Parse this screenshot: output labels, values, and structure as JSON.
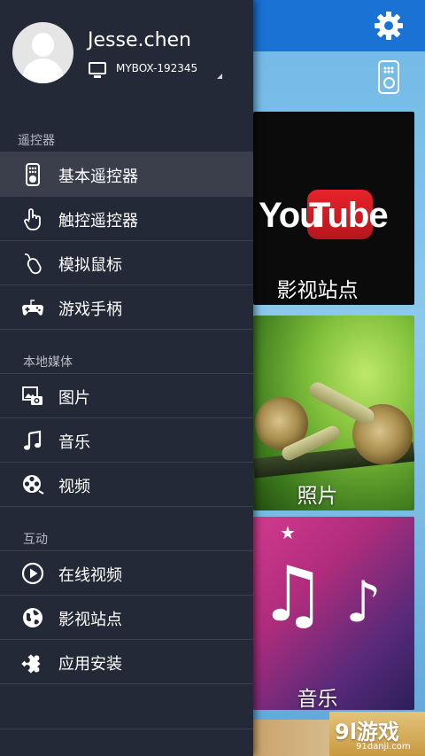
{
  "profile": {
    "user_name": "Jesse.chen",
    "device_name": "MYBOX-192345"
  },
  "drawer": {
    "sections": [
      {
        "header": "遥控器",
        "items": [
          {
            "label": "基本遥控器",
            "icon": "remote-icon",
            "selected": true
          },
          {
            "label": "触控遥控器",
            "icon": "touch-hand-icon"
          },
          {
            "label": "模拟鼠标",
            "icon": "mouse-icon"
          },
          {
            "label": "游戏手柄",
            "icon": "gamepad-icon"
          }
        ]
      },
      {
        "header": "本地媒体",
        "items": [
          {
            "label": "图片",
            "icon": "pictures-icon"
          },
          {
            "label": "音乐",
            "icon": "music-note-icon"
          },
          {
            "label": "视频",
            "icon": "film-reel-icon"
          }
        ]
      },
      {
        "header": "互动",
        "items": [
          {
            "label": "在线视频",
            "icon": "play-circle-icon"
          },
          {
            "label": "影视站点",
            "icon": "globe-icon"
          },
          {
            "label": "应用安装",
            "icon": "puzzle-icon"
          }
        ]
      }
    ]
  },
  "background": {
    "tiles": [
      {
        "caption": "影视站点",
        "logo_left": "You",
        "logo_right": "Tube"
      },
      {
        "caption": "照片"
      },
      {
        "caption": "音乐"
      }
    ],
    "watermark": {
      "logo": "9l游戏",
      "url": "91danji.com"
    }
  },
  "colors": {
    "drawer_bg": "#232936",
    "selected_bg": "#3a3f4b",
    "topbar_blue": "#1a72d4",
    "youtube_red": "#e8232b"
  }
}
